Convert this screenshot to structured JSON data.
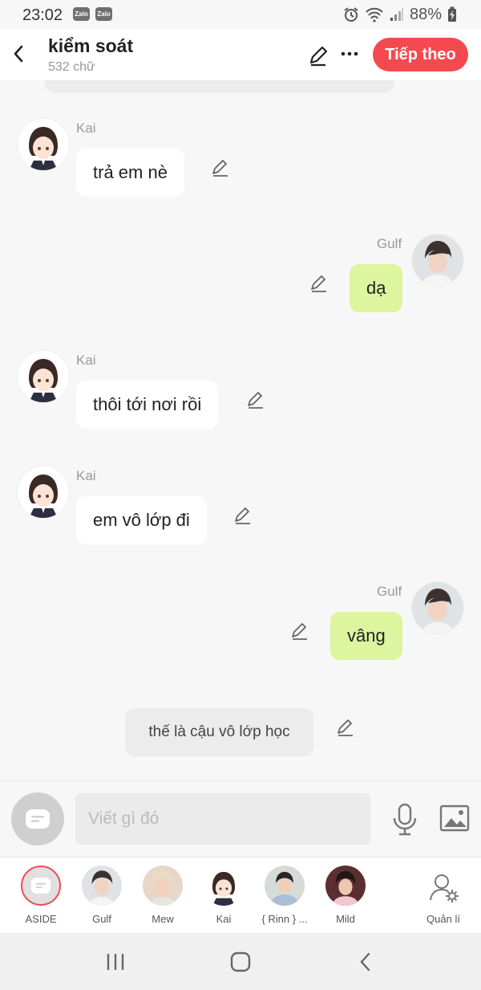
{
  "status": {
    "time": "23:02",
    "notifications": [
      "Zalo",
      "Zalo"
    ],
    "battery": "88%"
  },
  "header": {
    "title": "kiểm soát",
    "subtitle": "532 chữ",
    "next_label": "Tiếp theo"
  },
  "messages": [
    {
      "sender": "Kai",
      "text": "trả em nè",
      "side": "left"
    },
    {
      "sender": "Gulf",
      "text": "dạ",
      "side": "right"
    },
    {
      "sender": "Kai",
      "text": "thôi tới nơi rồi",
      "side": "left"
    },
    {
      "sender": "Kai",
      "text": "em vô lớp đi",
      "side": "left"
    },
    {
      "sender": "Gulf",
      "text": "vâng",
      "side": "right"
    },
    {
      "sender": "",
      "text": "thế là cậu vô lớp học",
      "side": "narration"
    }
  ],
  "composer": {
    "placeholder": "Viết gì đó"
  },
  "characters": [
    {
      "name": "ASIDE"
    },
    {
      "name": "Gulf"
    },
    {
      "name": "Mew"
    },
    {
      "name": "Kai"
    },
    {
      "name": "{ Rinn } ..."
    },
    {
      "name": "Mild"
    }
  ],
  "manage_label": "Quản lí",
  "colors": {
    "accent": "#f44a4f",
    "right_bubble": "#dcf59e",
    "left_bubble": "#ffffff",
    "background": "#f7f7f7"
  },
  "icons": [
    "back-arrow-icon",
    "pencil-icon",
    "more-icon",
    "chat-bubble-icon",
    "microphone-icon",
    "image-icon",
    "manage-user-icon",
    "recents-icon",
    "home-icon",
    "nav-back-icon"
  ]
}
